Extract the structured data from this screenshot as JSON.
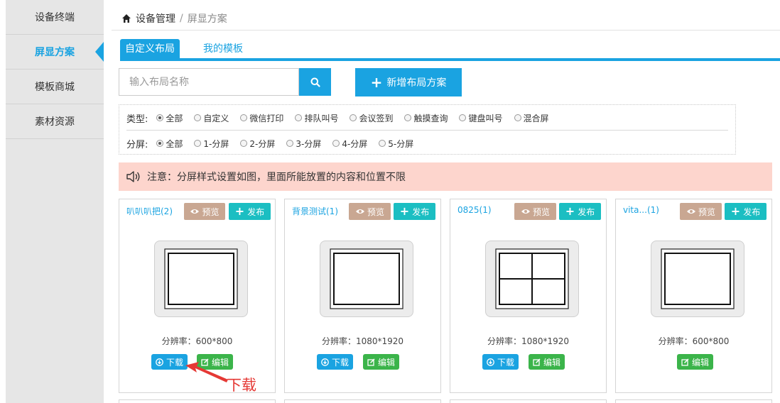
{
  "sidebar": {
    "items": [
      {
        "label": "设备终端",
        "active": false
      },
      {
        "label": "屏显方案",
        "active": true
      },
      {
        "label": "模板商城",
        "active": false
      },
      {
        "label": "素材资源",
        "active": false
      }
    ]
  },
  "breadcrumb": {
    "home": "设备管理",
    "separator": "/",
    "current": "屏显方案"
  },
  "tabs": [
    {
      "label": "自定义布局",
      "active": true
    },
    {
      "label": "我的模板",
      "active": false
    }
  ],
  "search": {
    "placeholder": "输入布局名称",
    "value": ""
  },
  "add_button": {
    "label": "新增布局方案"
  },
  "filters": {
    "type": {
      "label": "类型:",
      "options": [
        "全部",
        "自定义",
        "微信打印",
        "排队叫号",
        "会议签到",
        "触摸查询",
        "键盘叫号",
        "混合屏"
      ],
      "selected": "全部"
    },
    "split": {
      "label": "分屏:",
      "options": [
        "全部",
        "1-分屏",
        "2-分屏",
        "3-分屏",
        "4-分屏",
        "5-分屏"
      ],
      "selected": "全部"
    }
  },
  "notice": {
    "text": "注意：分屏样式设置如图，里面所能放置的内容和位置不限"
  },
  "cards": [
    {
      "title": "叭叭叭把(2)",
      "preview": "预览",
      "publish": "发布",
      "resolution": "分辨率：600*800",
      "download": "下载",
      "edit": "编辑",
      "layout": "single",
      "has_download": true
    },
    {
      "title": "背景测试(1)",
      "preview": "预览",
      "publish": "发布",
      "resolution": "分辨率：1080*1920",
      "download": "下载",
      "edit": "编辑",
      "layout": "single",
      "has_download": true
    },
    {
      "title": "0825(1)",
      "preview": "预览",
      "publish": "发布",
      "resolution": "分辨率：1080*1920",
      "download": "下载",
      "edit": "编辑",
      "layout": "quad",
      "has_download": true
    },
    {
      "title": "vita...(1)",
      "preview": "预览",
      "publish": "发布",
      "resolution": "分辨率：600*800",
      "edit": "编辑",
      "layout": "single",
      "has_download": false
    }
  ],
  "annotation": {
    "text": "下载",
    "color": "#e53935"
  },
  "colors": {
    "primary": "#1aa3e1",
    "preview": "#c9a792",
    "publish": "#1bbec2",
    "edit": "#3bb44a",
    "notice_bg": "#fdd5cd",
    "sidebar_bg": "#e6e6e6"
  }
}
